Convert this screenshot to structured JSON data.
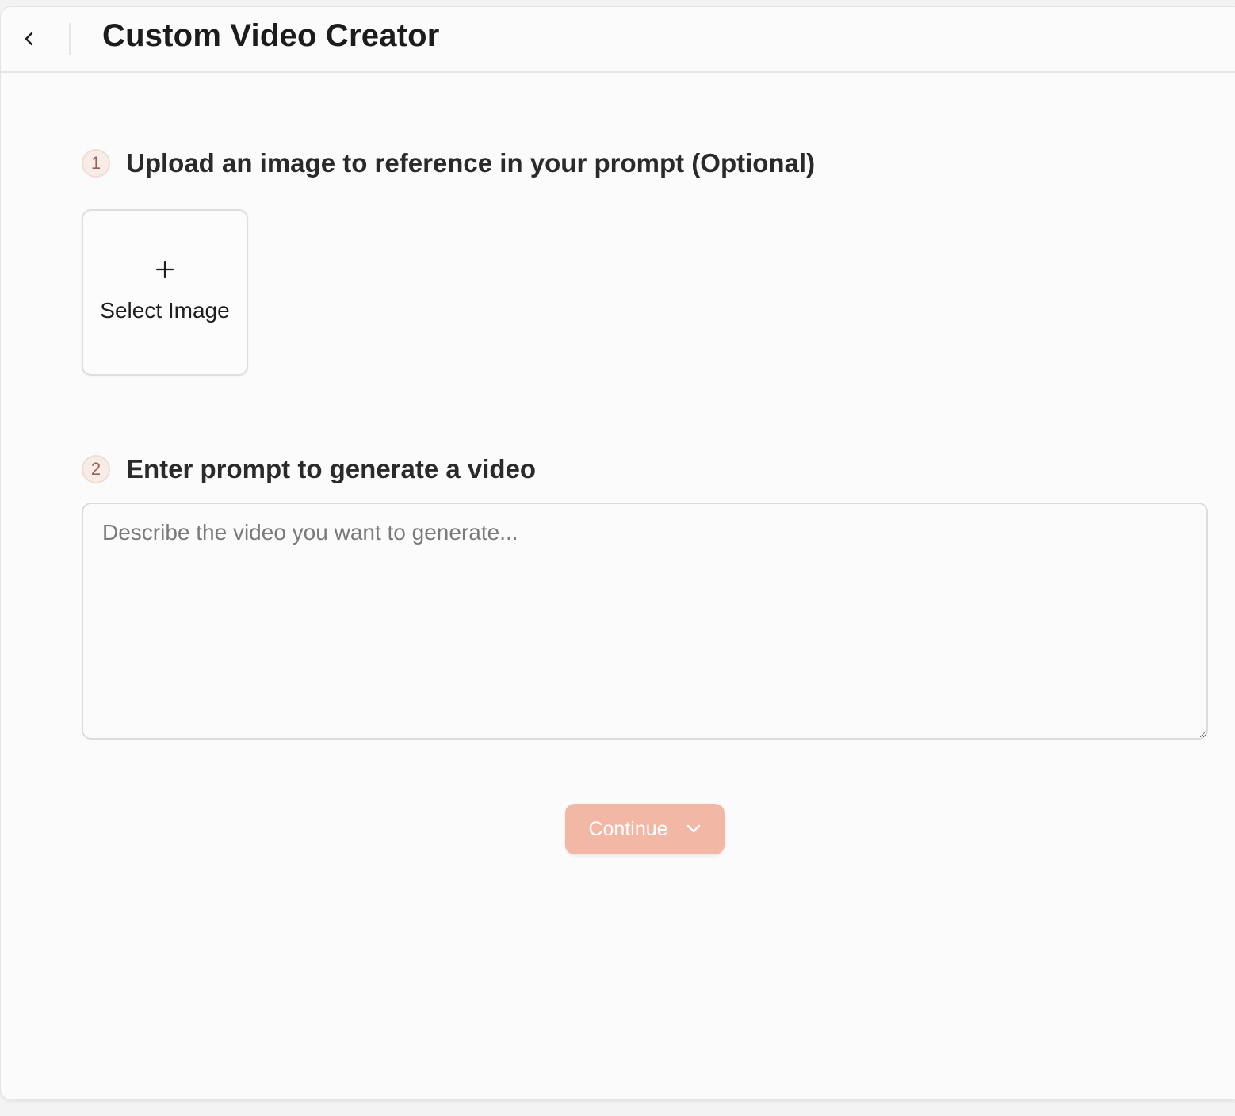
{
  "header": {
    "back_icon": "chevron-left-icon",
    "title": "Custom Video Creator"
  },
  "steps": [
    {
      "number": "1",
      "title": "Upload an image to reference in your prompt (Optional)"
    },
    {
      "number": "2",
      "title": "Enter prompt to generate a video"
    }
  ],
  "upload": {
    "icon": "plus-icon",
    "label": "Select Image"
  },
  "prompt": {
    "value": "",
    "placeholder": "Describe the video you want to generate..."
  },
  "actions": {
    "continue_label": "Continue",
    "continue_icon": "chevron-down-icon"
  },
  "colors": {
    "accent": "#f2b8a5",
    "badge_bg": "#f7ece8",
    "badge_text": "#9a6252",
    "background": "#fbfbfb"
  }
}
